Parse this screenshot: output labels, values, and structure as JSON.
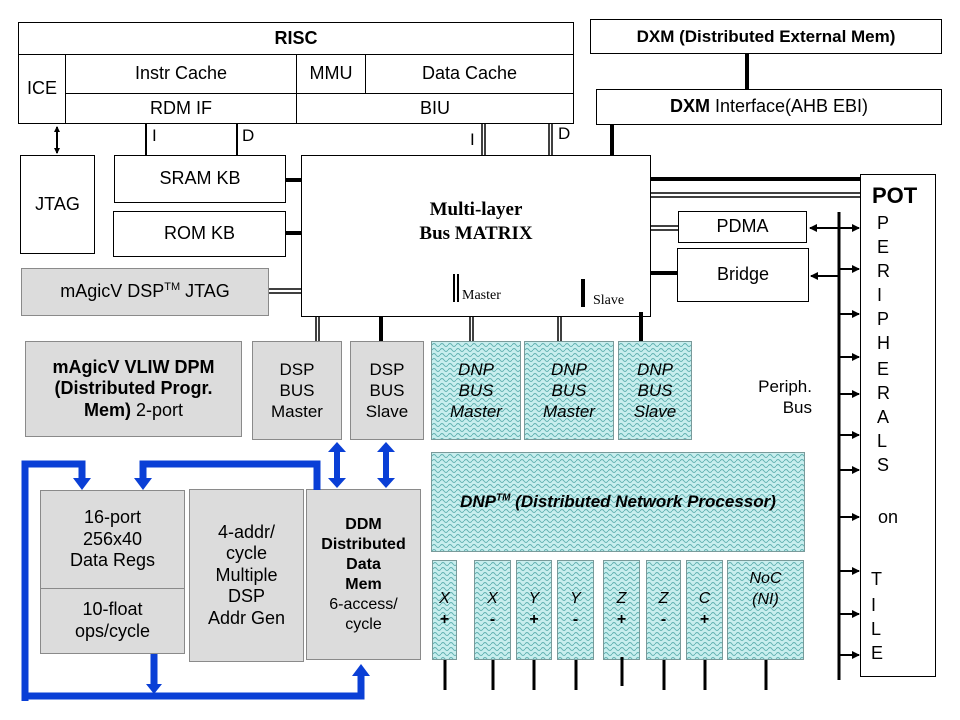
{
  "risc": {
    "title": "RISC",
    "ice": "ICE",
    "instr_cache": "Instr Cache",
    "mmu": "MMU",
    "data_cache": "Data Cache",
    "rdm_if": "RDM IF",
    "biu": "BIU"
  },
  "bus_labels": {
    "i1": "I",
    "d1": "D",
    "i2": "I",
    "d2": "D"
  },
  "dxm": {
    "title": "DXM (Distributed External Mem)",
    "interface_bold": "DXM",
    "interface_rest": " Interface(AHB EBI)"
  },
  "left_blocks": {
    "jtag": "JTAG",
    "sram": "SRAM KB",
    "rom": "ROM KB",
    "magicv_jtag_pre": "mAgicV DSP",
    "magicv_jtag_tm": "TM",
    "magicv_jtag_post": " JTAG"
  },
  "bus_matrix": {
    "line1": "Multi-layer",
    "line2": "Bus MATRIX",
    "legend_master": "Master",
    "legend_slave": "Slave"
  },
  "right_blocks": {
    "pdma": "PDMA",
    "bridge": "Bridge",
    "periph_bus_1": "Periph.",
    "periph_bus_2": "Bus"
  },
  "pot": {
    "title": "POT",
    "letters": [
      "P",
      "E",
      "R",
      "I",
      "P",
      "H",
      "E",
      "R",
      "A",
      "L",
      "S",
      "",
      "on",
      "",
      "T",
      "I",
      "L",
      "E"
    ]
  },
  "dpm": {
    "line1": "mAgicV VLIW DPM",
    "line2": "(Distributed Progr.",
    "line3_bold": "Mem)",
    "line3_rest": " 2-port"
  },
  "dsp_bus": [
    {
      "l1": "DSP",
      "l2": "BUS",
      "l3": "Master"
    },
    {
      "l1": "DSP",
      "l2": "BUS",
      "l3": "Slave"
    }
  ],
  "dnp_bus": [
    {
      "l1": "DNP",
      "l2": "BUS",
      "l3": "Master"
    },
    {
      "l1": "DNP",
      "l2": "BUS",
      "l3": "Master"
    },
    {
      "l1": "DNP",
      "l2": "BUS",
      "l3": "Slave"
    }
  ],
  "dnp": {
    "name": "DNP",
    "tm": "TM",
    "rest": " (Distributed Network Processor)"
  },
  "dnp_ports": [
    {
      "axis": "X",
      "sign": "+"
    },
    {
      "axis": "X",
      "sign": "-"
    },
    {
      "axis": "Y",
      "sign": "+"
    },
    {
      "axis": "Y",
      "sign": "-"
    },
    {
      "axis": "Z",
      "sign": "+"
    },
    {
      "axis": "Z",
      "sign": "-"
    },
    {
      "axis": "C",
      "sign": "+"
    },
    {
      "axis": "NoC",
      "sign": "(NI)"
    }
  ],
  "dsp_core": {
    "regs": [
      "16-port",
      "256x40",
      "Data Regs"
    ],
    "float": [
      "10-float",
      "ops/cycle"
    ],
    "addr_gen": [
      "4-addr/",
      "cycle",
      "Multiple",
      "DSP",
      "Addr Gen"
    ],
    "ddm_bold": [
      "DDM",
      "Distributed",
      "Data",
      "Mem"
    ],
    "ddm_rest": [
      "6-access/",
      "cycle"
    ]
  },
  "colors": {
    "flow_blue": "#0a3fd6",
    "gray_block": "#dcdcdc",
    "dnp_fill": "#c8eeee"
  }
}
